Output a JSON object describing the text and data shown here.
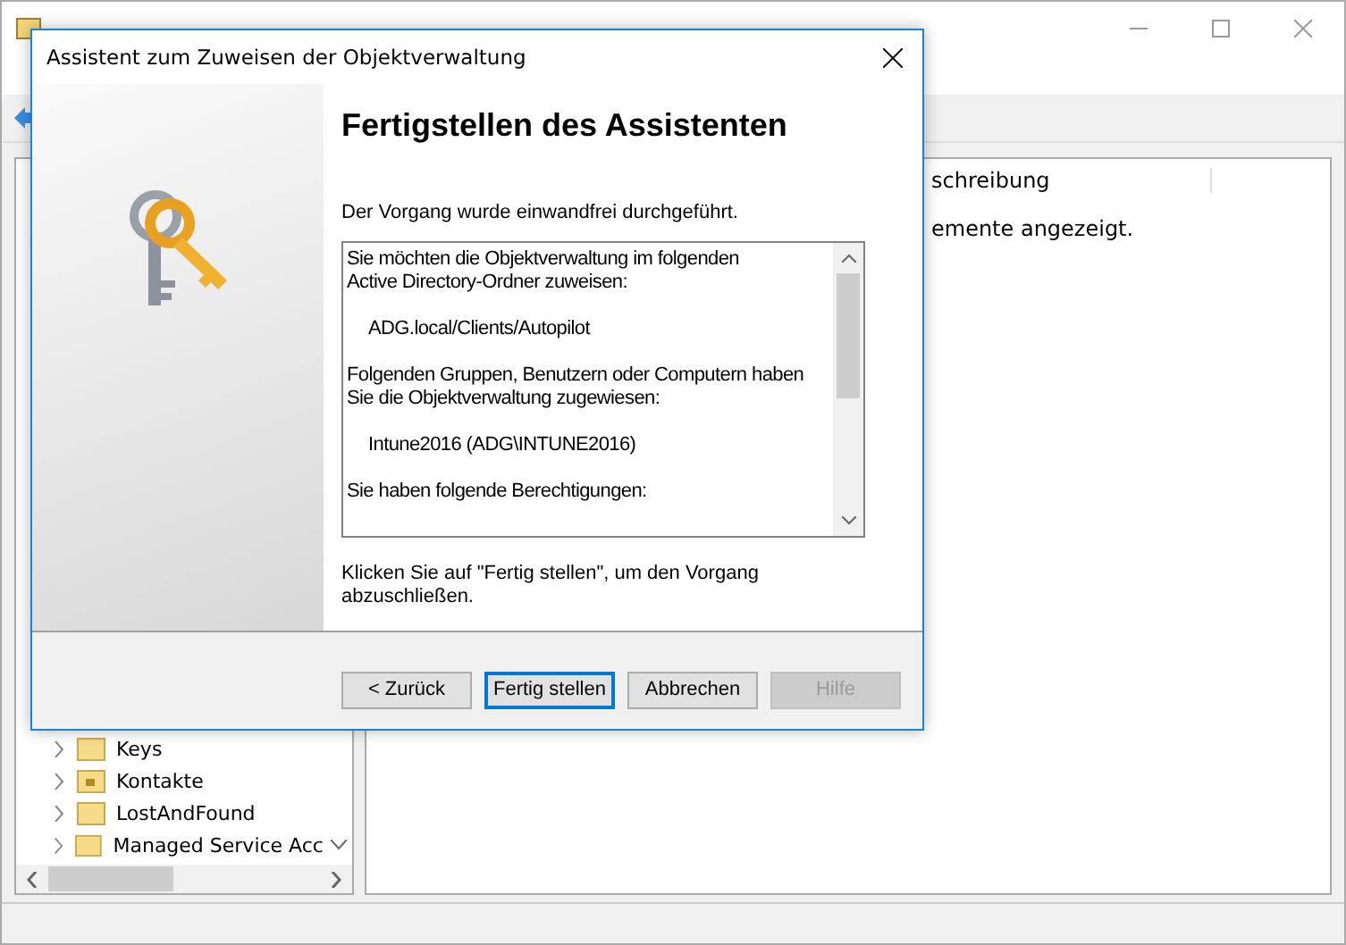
{
  "main_window": {
    "tree": [
      {
        "label": "Keys",
        "kind": "folder",
        "expanded": false
      },
      {
        "label": "Kontakte",
        "kind": "special",
        "expanded": false
      },
      {
        "label": "LostAndFound",
        "kind": "folder",
        "expanded": false
      },
      {
        "label": "Managed Service Acc",
        "kind": "folder",
        "expanded": false
      }
    ],
    "list_header": "schreibung",
    "list_message": "emente angezeigt."
  },
  "dialog": {
    "title": "Assistent zum Zuweisen der Objektverwaltung",
    "heading": "Fertigstellen des Assistenten",
    "status": "Der Vorgang wurde einwandfrei durchgeführt.",
    "summary": [
      {
        "text": "Sie möchten die Objektverwaltung im folgenden\nActive Directory-Ordner zuweisen:",
        "indent": false
      },
      {
        "text": "ADG.local/Clients/Autopilot",
        "indent": true
      },
      {
        "text": "Folgenden Gruppen, Benutzern oder Computern haben\nSie die Objektverwaltung zugewiesen:",
        "indent": false
      },
      {
        "text": "Intune2016 (ADG\\INTUNE2016)",
        "indent": true
      },
      {
        "text": "Sie haben folgende Berechtigungen:",
        "indent": false
      }
    ],
    "hint": "Klicken Sie auf \"Fertig stellen\", um den Vorgang\nabzuschließen.",
    "buttons": [
      {
        "label": "< Zurück",
        "disabled": false,
        "default": false
      },
      {
        "label": "Fertig stellen",
        "disabled": false,
        "default": true
      },
      {
        "label": "Abbrechen",
        "disabled": false,
        "default": false
      },
      {
        "label": "Hilfe",
        "disabled": true,
        "default": false
      }
    ]
  }
}
